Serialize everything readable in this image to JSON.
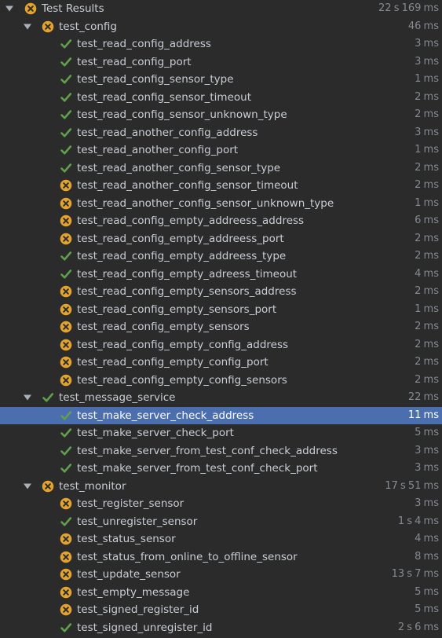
{
  "colors": {
    "passed": "#5fa14b",
    "failed": "#e3a32c",
    "selected": "#4b6eaf"
  },
  "root": {
    "label": "Test Results",
    "duration": "22 s 169 ms",
    "status": "failed",
    "arrow": "chevron-down-icon"
  },
  "suites": [
    {
      "label": "test_config",
      "duration": "46 ms",
      "status": "failed",
      "tests": [
        {
          "label": "test_read_config_address",
          "duration": "3 ms",
          "status": "passed"
        },
        {
          "label": "test_read_config_port",
          "duration": "3 ms",
          "status": "passed"
        },
        {
          "label": "test_read_config_sensor_type",
          "duration": "1 ms",
          "status": "passed"
        },
        {
          "label": "test_read_config_sensor_timeout",
          "duration": "2 ms",
          "status": "passed"
        },
        {
          "label": "test_read_config_sensor_unknown_type",
          "duration": "2 ms",
          "status": "passed"
        },
        {
          "label": "test_read_another_config_address",
          "duration": "3 ms",
          "status": "passed"
        },
        {
          "label": "test_read_another_config_port",
          "duration": "1 ms",
          "status": "passed"
        },
        {
          "label": "test_read_another_config_sensor_type",
          "duration": "2 ms",
          "status": "passed"
        },
        {
          "label": "test_read_another_config_sensor_timeout",
          "duration": "2 ms",
          "status": "failed"
        },
        {
          "label": "test_read_another_config_sensor_unknown_type",
          "duration": "1 ms",
          "status": "failed"
        },
        {
          "label": "test_read_config_empty_addreess_address",
          "duration": "6 ms",
          "status": "failed"
        },
        {
          "label": "test_read_config_empty_addreess_port",
          "duration": "2 ms",
          "status": "failed"
        },
        {
          "label": "test_read_config_empty_addreess_type",
          "duration": "2 ms",
          "status": "passed"
        },
        {
          "label": "test_read_config_empty_adreess_timeout",
          "duration": "4 ms",
          "status": "passed"
        },
        {
          "label": "test_read_config_empty_sensors_address",
          "duration": "2 ms",
          "status": "failed"
        },
        {
          "label": "test_read_config_empty_sensors_port",
          "duration": "1 ms",
          "status": "failed"
        },
        {
          "label": "test_read_config_empty_sensors",
          "duration": "2 ms",
          "status": "failed"
        },
        {
          "label": "test_read_config_empty_config_address",
          "duration": "2 ms",
          "status": "failed"
        },
        {
          "label": "test_read_config_empty_config_port",
          "duration": "2 ms",
          "status": "failed"
        },
        {
          "label": "test_read_config_empty_config_sensors",
          "duration": "2 ms",
          "status": "failed"
        }
      ]
    },
    {
      "label": "test_message_service",
      "duration": "22 ms",
      "status": "passed",
      "tests": [
        {
          "label": "test_make_server_check_address",
          "duration": "11 ms",
          "status": "passed",
          "selected": true
        },
        {
          "label": "test_make_server_check_port",
          "duration": "5 ms",
          "status": "passed"
        },
        {
          "label": "test_make_server_from_test_conf_check_address",
          "duration": "3 ms",
          "status": "passed"
        },
        {
          "label": "test_make_server_from_test_conf_check_port",
          "duration": "3 ms",
          "status": "passed"
        }
      ]
    },
    {
      "label": "test_monitor",
      "duration": "17 s 51 ms",
      "status": "failed",
      "tests": [
        {
          "label": "test_register_sensor",
          "duration": "3 ms",
          "status": "failed"
        },
        {
          "label": "test_unregister_sensor",
          "duration": "1 s 4 ms",
          "status": "passed"
        },
        {
          "label": "test_status_sensor",
          "duration": "4 ms",
          "status": "failed"
        },
        {
          "label": "test_status_from_online_to_offline_sensor",
          "duration": "8 ms",
          "status": "failed"
        },
        {
          "label": "test_update_sensor",
          "duration": "13 s 7 ms",
          "status": "failed"
        },
        {
          "label": "test_empty_message",
          "duration": "5 ms",
          "status": "failed"
        },
        {
          "label": "test_signed_register_id",
          "duration": "5 ms",
          "status": "failed"
        },
        {
          "label": "test_signed_unregister_id",
          "duration": "2 s 6 ms",
          "status": "passed"
        }
      ]
    }
  ]
}
